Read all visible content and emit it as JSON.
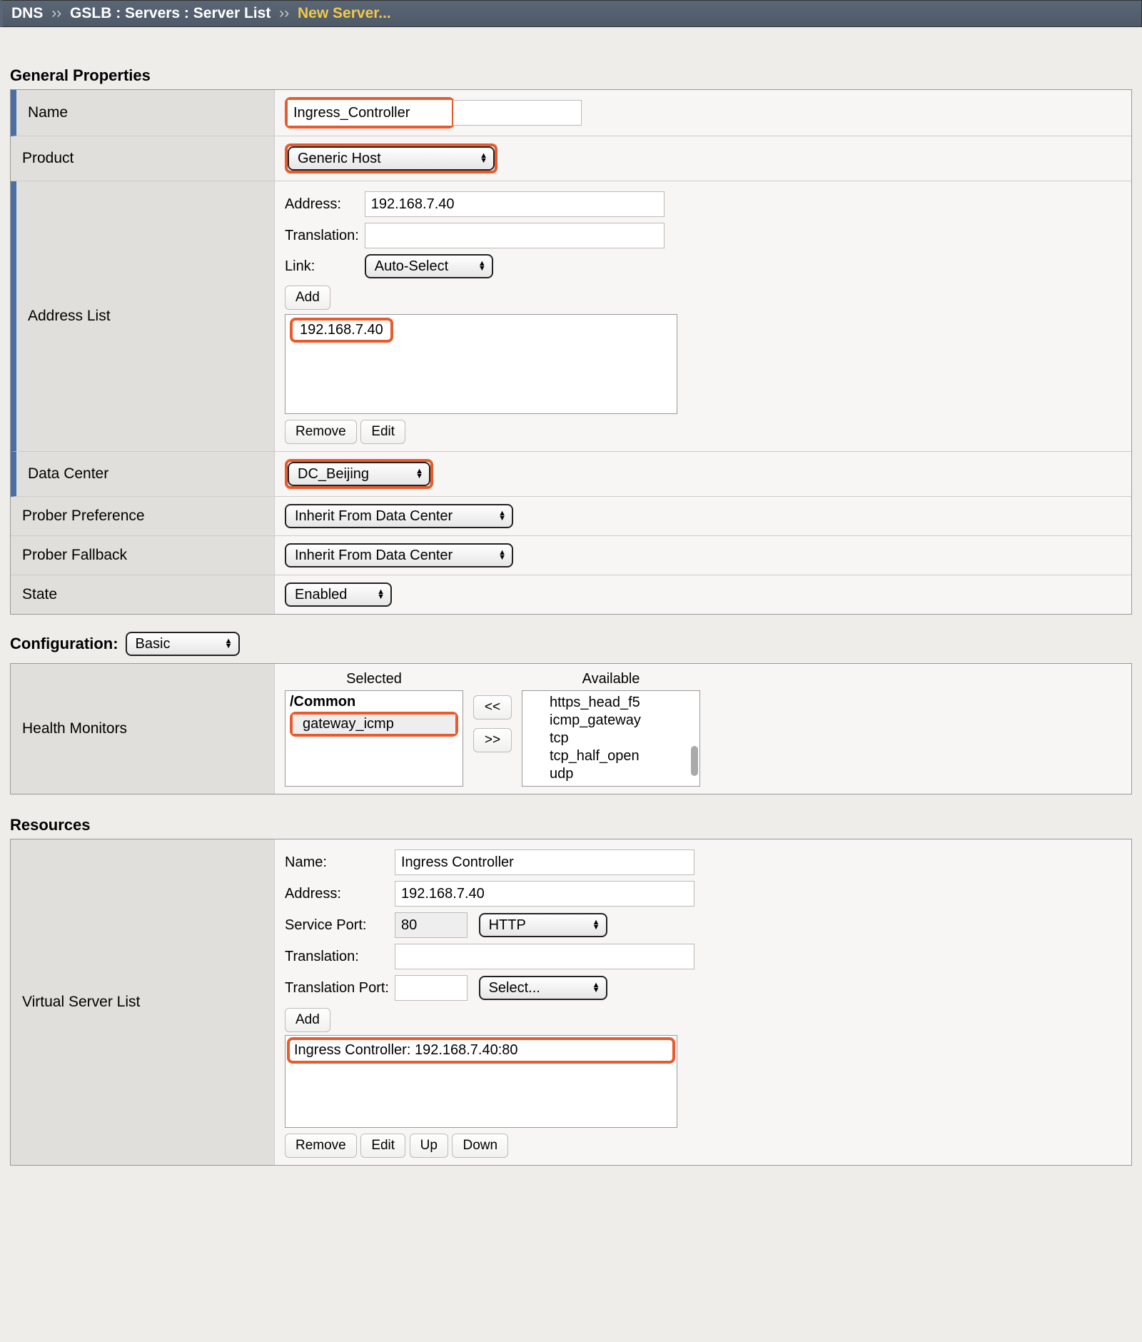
{
  "breadcrumb": {
    "root": "DNS",
    "path": "GSLB : Servers : Server List",
    "current": "New Server..."
  },
  "sections": {
    "general": "General Properties",
    "config": "Configuration:",
    "resources": "Resources"
  },
  "general": {
    "name_label": "Name",
    "name_value": "Ingress_Controller",
    "product_label": "Product",
    "product_value": "Generic Host",
    "addresslist_label": "Address List",
    "address_label": "Address:",
    "address_value": "192.168.7.40",
    "translation_label": "Translation:",
    "translation_value": "",
    "link_label": "Link:",
    "link_value": "Auto-Select",
    "add_btn": "Add",
    "address_items": [
      "192.168.7.40"
    ],
    "remove_btn": "Remove",
    "edit_btn": "Edit",
    "datacenter_label": "Data Center",
    "datacenter_value": "DC_Beijing",
    "proberpref_label": "Prober Preference",
    "proberpref_value": "Inherit From Data Center",
    "proberfb_label": "Prober Fallback",
    "proberfb_value": "Inherit From Data Center",
    "state_label": "State",
    "state_value": "Enabled"
  },
  "configuration": {
    "mode": "Basic",
    "hmon_label": "Health Monitors",
    "selected_head": "Selected",
    "available_head": "Available",
    "selected_group": "/Common",
    "selected_items": [
      "gateway_icmp"
    ],
    "available_items": [
      "https_head_f5",
      "icmp_gateway",
      "tcp",
      "tcp_half_open",
      "udp"
    ],
    "move_left": "<<",
    "move_right": ">>"
  },
  "resources": {
    "vslist_label": "Virtual Server List",
    "name_label": "Name:",
    "name_value": "Ingress Controller",
    "address_label": "Address:",
    "address_value": "192.168.7.40",
    "port_label": "Service Port:",
    "port_value": "80",
    "port_proto": "HTTP",
    "translation_label": "Translation:",
    "translation_value": "",
    "tport_label": "Translation Port:",
    "tport_value": "",
    "tport_select": "Select...",
    "add_btn": "Add",
    "vs_items": [
      "Ingress Controller: 192.168.7.40:80"
    ],
    "remove_btn": "Remove",
    "edit_btn": "Edit",
    "up_btn": "Up",
    "down_btn": "Down"
  }
}
